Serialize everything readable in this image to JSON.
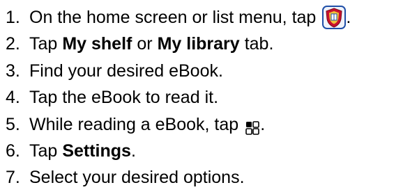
{
  "steps": [
    {
      "num": "1.",
      "before": "On the home screen or list menu, tap",
      "after": ".",
      "icon": "app-shield-icon"
    },
    {
      "num": "2.",
      "before": "Tap",
      "bold1": "My shelf",
      "middle": "or",
      "bold2": "My library",
      "after": "tab."
    },
    {
      "num": "3.",
      "text": "Find your desired eBook."
    },
    {
      "num": "4.",
      "text": "Tap the eBook to read it."
    },
    {
      "num": "5.",
      "before": "While reading a eBook, tap",
      "after": ".",
      "icon": "menu-grid-icon"
    },
    {
      "num": "6.",
      "before": "Tap",
      "bold": "Settings",
      "after": "."
    },
    {
      "num": "7.",
      "text": "Select your desired options."
    }
  ],
  "colors": {
    "text": "#000000",
    "icon_shield_red": "#c8102e",
    "icon_shield_gold": "#f2c23a",
    "icon_shield_blue": "#1f4fa8"
  }
}
